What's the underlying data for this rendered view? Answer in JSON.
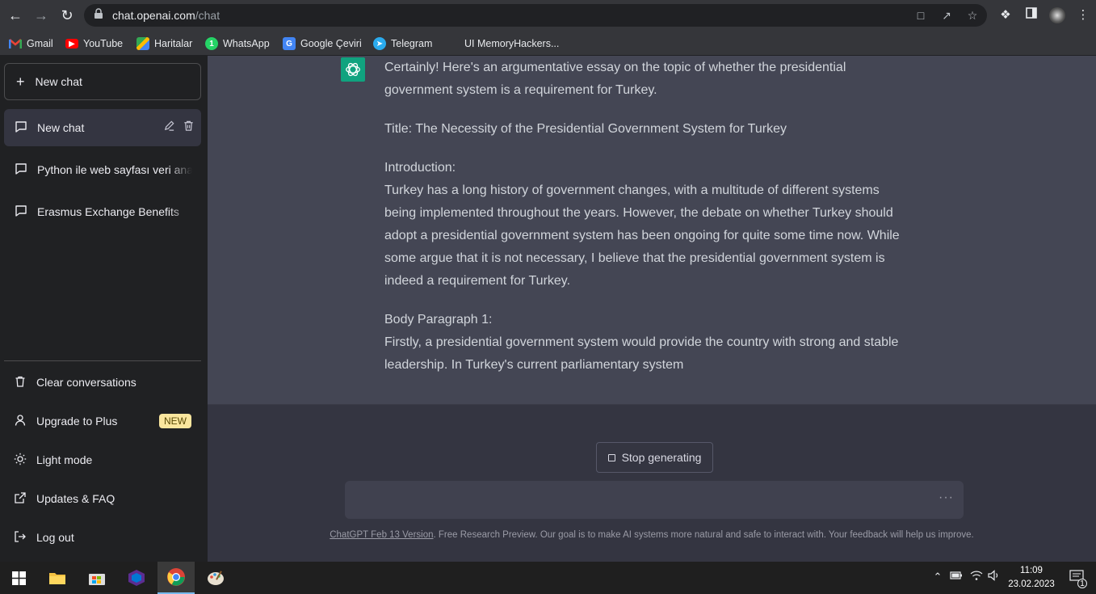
{
  "browser": {
    "url_domain": "chat.openai.com",
    "url_path": "/chat",
    "bookmarks": [
      {
        "label": "Gmail",
        "icon": "gmail-icon"
      },
      {
        "label": "YouTube",
        "icon": "youtube-icon"
      },
      {
        "label": "Haritalar",
        "icon": "maps-icon"
      },
      {
        "label": "WhatsApp",
        "icon": "whatsapp-icon"
      },
      {
        "label": "Google Çeviri",
        "icon": "google-translate-icon"
      },
      {
        "label": "Telegram",
        "icon": "telegram-icon"
      },
      {
        "label": "UI MemoryHackers...",
        "icon": "memoryhackers-icon"
      }
    ]
  },
  "sidebar": {
    "new_chat_label": "New chat",
    "conversations": [
      {
        "label": "New chat"
      },
      {
        "label": "Python ile web sayfası veri analizi"
      },
      {
        "label": "Erasmus Exchange Benefits"
      }
    ],
    "menu": {
      "clear": "Clear conversations",
      "upgrade": "Upgrade to Plus",
      "upgrade_badge": "NEW",
      "light_mode": "Light mode",
      "updates": "Updates & FAQ",
      "logout": "Log out"
    }
  },
  "chat": {
    "response": {
      "intro": "Certainly! Here's an argumentative essay on the topic of whether the presidential government system is a requirement for Turkey.",
      "title": "Title: The Necessity of the Presidential Government System for Turkey",
      "introduction_heading": "Introduction:",
      "introduction_body": "Turkey has a long history of government changes, with a multitude of different systems being implemented throughout the years. However, the debate on whether Turkey should adopt a presidential government system has been ongoing for quite some time now. While some argue that it is not necessary, I believe that the presidential government system is indeed a requirement for Turkey.",
      "body1_heading": "Body Paragraph 1:",
      "body1_text": "Firstly, a presidential government system would provide the country with strong and stable leadership. In Turkey's current parliamentary system"
    },
    "stop_label": "Stop generating",
    "input_placeholder": "",
    "input_indicator": "···",
    "footer_link": "ChatGPT Feb 13 Version",
    "footer_text": ". Free Research Preview. Our goal is to make AI systems more natural and safe to interact with. Your feedback will help us improve."
  },
  "taskbar": {
    "time": "11:09",
    "date": "23.02.2023",
    "notification_count": "1"
  },
  "colors": {
    "sidebar_bg": "#202123",
    "main_bg": "#343541",
    "message_bg": "#444654",
    "accent": "#10a37f",
    "badge_bg": "#fae69e"
  }
}
